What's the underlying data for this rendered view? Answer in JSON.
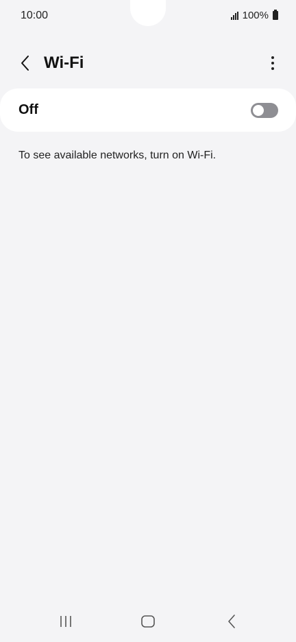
{
  "status_bar": {
    "time": "10:00",
    "battery": "100%",
    "signal_icon": "signal-icon",
    "battery_icon": "battery-icon"
  },
  "app_bar": {
    "title": "Wi-Fi",
    "back_icon": "chevron-left-icon",
    "more_icon": "more-vertical-icon"
  },
  "wifi_toggle": {
    "label": "Off",
    "state": "off"
  },
  "info": {
    "message": "To see available networks, turn on Wi-Fi."
  },
  "nav_bar": {
    "recents_icon": "recents-icon",
    "home_icon": "home-icon",
    "back_icon": "back-icon"
  },
  "colors": {
    "background": "#f4f4f6",
    "card": "#ffffff",
    "toggle_off": "#8e8e93"
  }
}
